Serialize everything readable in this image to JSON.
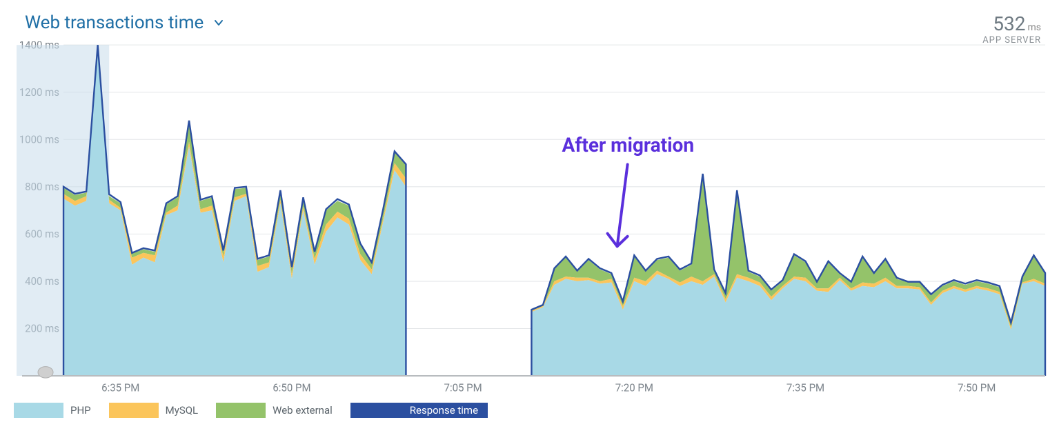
{
  "header": {
    "title": "Web transactions time",
    "dropdown_icon": "chevron-down",
    "stat_value": "532",
    "stat_unit": "ms",
    "stat_label": "APP SERVER"
  },
  "annotation": {
    "text": "After migration"
  },
  "legend": {
    "php": "PHP",
    "mysql": "MySQL",
    "webext": "Web external",
    "response": "Response time"
  },
  "chart_data": {
    "type": "area",
    "title": "Web transactions time",
    "ylabel": "ms",
    "ylim": [
      0,
      1400
    ],
    "y_ticks": [
      200,
      400,
      600,
      800,
      1000,
      1200,
      1400
    ],
    "y_tick_suffix": " ms",
    "x_ticks": [
      "6:35 PM",
      "6:50 PM",
      "7:05 PM",
      "7:20 PM",
      "7:35 PM",
      "7:50 PM"
    ],
    "x_tick_indices": [
      5,
      20,
      35,
      50,
      65,
      80
    ],
    "shaded_region": [
      0,
      4
    ],
    "series": [
      {
        "name": "PHP",
        "color": "#a8d9e6"
      },
      {
        "name": "MySQL",
        "color": "#fbc55b"
      },
      {
        "name": "Web external",
        "color": "#94c36a"
      },
      {
        "name": "Response time",
        "color": "#2b4fa0"
      }
    ],
    "stack": {
      "php": [
        750,
        720,
        740,
        1390,
        730,
        700,
        470,
        500,
        480,
        680,
        700,
        970,
        690,
        700,
        480,
        740,
        760,
        440,
        460,
        730,
        410,
        700,
        470,
        610,
        670,
        640,
        490,
        430,
        650,
        870,
        800,
        0,
        0,
        0,
        0,
        0,
        0,
        0,
        0,
        0,
        0,
        270,
        290,
        385,
        410,
        400,
        405,
        390,
        395,
        280,
        400,
        380,
        430,
        410,
        380,
        400,
        385,
        420,
        310,
        415,
        400,
        380,
        320,
        370,
        410,
        400,
        360,
        355,
        405,
        360,
        380,
        375,
        400,
        370,
        370,
        365,
        300,
        350,
        370,
        355,
        370,
        360,
        345,
        195,
        390,
        400,
        380
      ],
      "mysql": [
        770,
        740,
        760,
        1395,
        745,
        710,
        500,
        520,
        510,
        690,
        720,
        990,
        705,
        720,
        505,
        755,
        770,
        465,
        480,
        745,
        430,
        715,
        495,
        640,
        695,
        665,
        515,
        450,
        665,
        900,
        835,
        0,
        0,
        0,
        0,
        0,
        0,
        0,
        0,
        0,
        0,
        275,
        295,
        400,
        420,
        415,
        415,
        400,
        410,
        295,
        415,
        400,
        445,
        420,
        395,
        420,
        400,
        430,
        325,
        430,
        415,
        395,
        335,
        380,
        420,
        415,
        370,
        370,
        415,
        370,
        395,
        390,
        415,
        380,
        380,
        375,
        310,
        360,
        380,
        365,
        380,
        370,
        355,
        205,
        395,
        410,
        390
      ],
      "web_external": [
        795,
        765,
        775,
        1398,
        760,
        730,
        517,
        535,
        525,
        725,
        755,
        1075,
        740,
        755,
        525,
        790,
        795,
        490,
        505,
        780,
        455,
        750,
        520,
        700,
        740,
        720,
        555,
        475,
        700,
        945,
        890,
        0,
        0,
        0,
        0,
        0,
        0,
        0,
        0,
        0,
        0,
        278,
        298,
        450,
        500,
        440,
        490,
        450,
        430,
        310,
        505,
        440,
        490,
        500,
        445,
        470,
        850,
        445,
        345,
        780,
        440,
        420,
        360,
        400,
        510,
        480,
        395,
        480,
        430,
        395,
        500,
        430,
        490,
        410,
        395,
        395,
        340,
        380,
        400,
        385,
        400,
        390,
        375,
        220,
        415,
        505,
        430
      ],
      "response_time": [
        800,
        770,
        780,
        1400,
        768,
        735,
        520,
        540,
        530,
        730,
        760,
        1080,
        745,
        760,
        530,
        795,
        800,
        495,
        510,
        785,
        460,
        755,
        525,
        705,
        748,
        725,
        560,
        480,
        705,
        950,
        895,
        0,
        0,
        0,
        0,
        0,
        0,
        0,
        0,
        0,
        0,
        280,
        300,
        455,
        505,
        445,
        495,
        455,
        435,
        315,
        510,
        445,
        495,
        505,
        450,
        475,
        855,
        450,
        350,
        785,
        445,
        425,
        365,
        405,
        515,
        485,
        398,
        485,
        435,
        398,
        505,
        435,
        495,
        415,
        398,
        398,
        345,
        385,
        405,
        390,
        405,
        395,
        380,
        225,
        420,
        510,
        435
      ]
    },
    "gap_range": [
      31,
      40
    ]
  }
}
